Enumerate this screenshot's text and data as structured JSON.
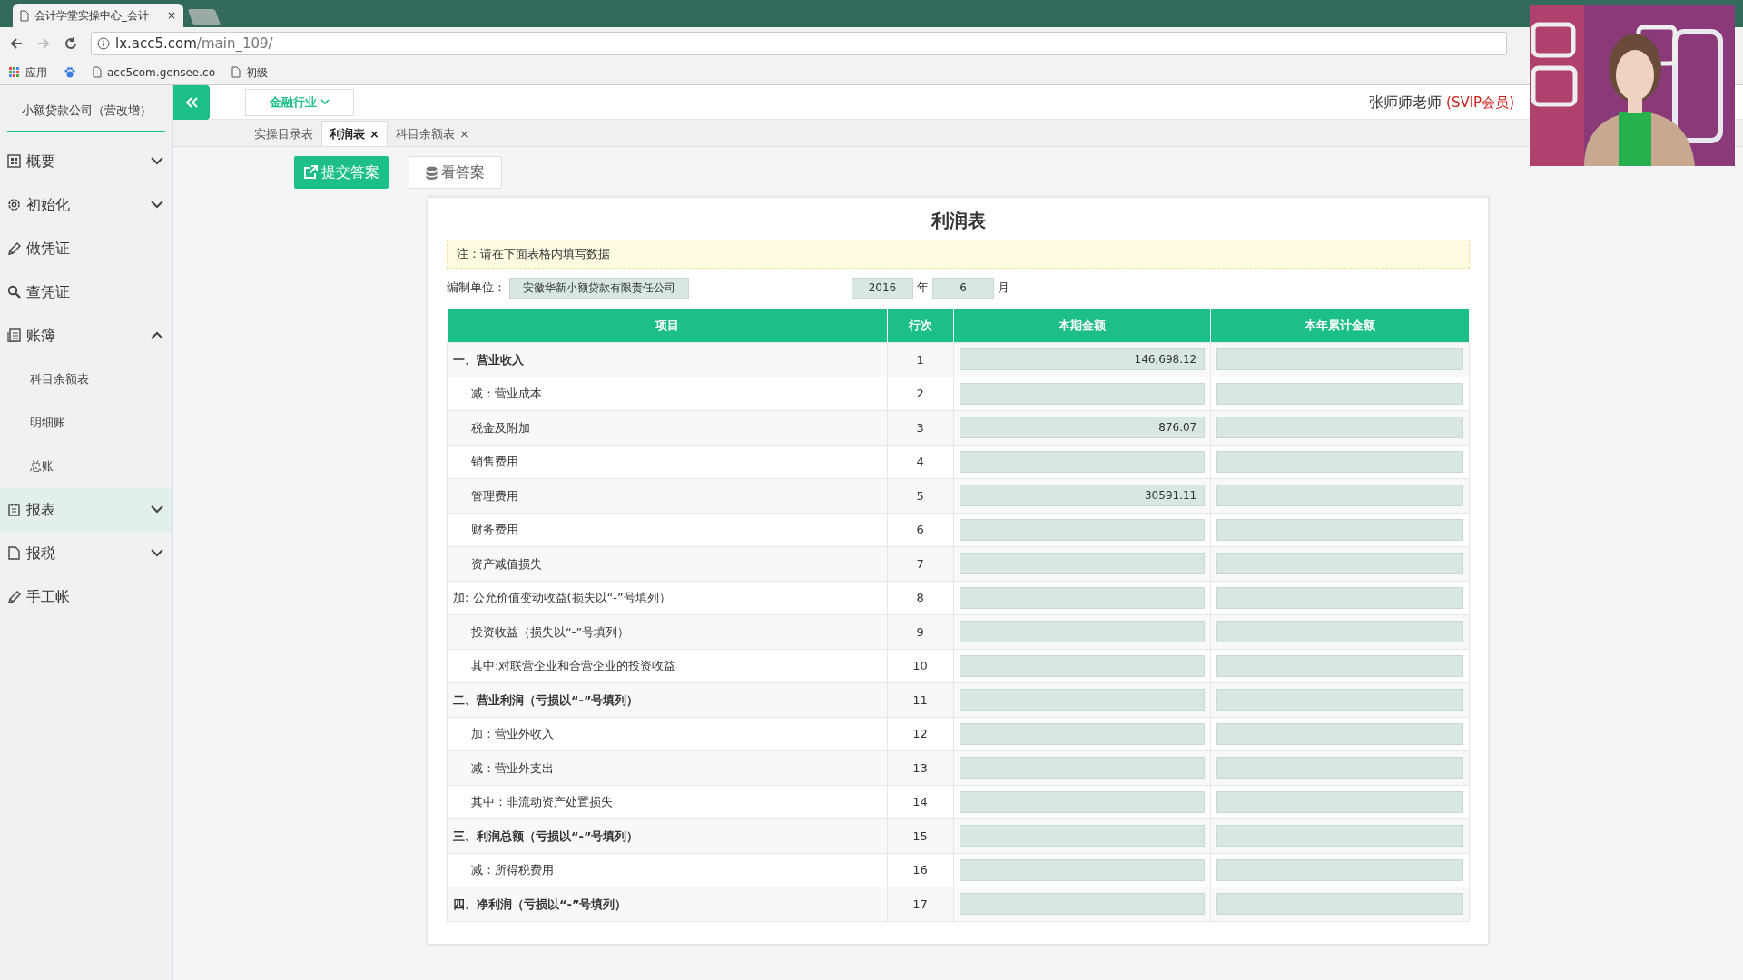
{
  "browser": {
    "tab_title": "会计学堂实操中心_会计",
    "tab_close": "×",
    "url_host": "lx.acc5.com",
    "url_path": "/main_109/",
    "bookmarks": [
      "应用",
      "acc5com.gensee.co",
      "初级"
    ]
  },
  "header": {
    "industry": "金融行业",
    "user": "张师师老师",
    "membership": "(SVIP会员)"
  },
  "sidebar": {
    "company": "小额贷款公司（营改增）",
    "items": [
      {
        "label": "概要",
        "kind": "group",
        "expanded": false,
        "selected": false
      },
      {
        "label": "初始化",
        "kind": "group",
        "expanded": false,
        "selected": false
      },
      {
        "label": "做凭证",
        "kind": "link",
        "selected": false
      },
      {
        "label": "查凭证",
        "kind": "link",
        "selected": false
      },
      {
        "label": "账簿",
        "kind": "group",
        "expanded": true,
        "selected": false,
        "children": [
          {
            "label": "科目余额表"
          },
          {
            "label": "明细账"
          },
          {
            "label": "总账"
          }
        ]
      },
      {
        "label": "报表",
        "kind": "group",
        "expanded": false,
        "selected": true
      },
      {
        "label": "报税",
        "kind": "group",
        "expanded": false,
        "selected": false
      },
      {
        "label": "手工帐",
        "kind": "link",
        "selected": false
      }
    ]
  },
  "tabs": [
    {
      "label": "实操目录表",
      "selected": false
    },
    {
      "label": "利润表",
      "selected": true,
      "close": "×"
    },
    {
      "label": "科目余额表",
      "selected": false,
      "close": "×"
    }
  ],
  "toolbar": [
    {
      "label": "提交答案",
      "kind": "primary"
    },
    {
      "label": "看答案",
      "kind": "secondary"
    }
  ],
  "report": {
    "title": "利润表",
    "note": "注：请在下面表格内填写数据",
    "unit_label": "编制单位：",
    "unit": "安徽华新小额贷款有限责任公司",
    "year": "2016",
    "year_label": "年",
    "month": "6",
    "month_label": "月",
    "columns": [
      "项目",
      "行次",
      "本期金额",
      "本年累计金额"
    ],
    "rows": [
      {
        "item": "一、营业收入",
        "kind": "main",
        "line": "1",
        "current": "146,698.12"
      },
      {
        "item": "减：营业成本",
        "kind": "sub",
        "line": "2"
      },
      {
        "item": "税金及附加",
        "kind": "sub",
        "line": "3",
        "current": "876.07"
      },
      {
        "item": "销售费用",
        "kind": "sub",
        "line": "4"
      },
      {
        "item": "管理费用",
        "kind": "sub",
        "line": "5",
        "current": "30591.11"
      },
      {
        "item": "财务费用",
        "kind": "sub",
        "line": "6"
      },
      {
        "item": "资产减值损失",
        "kind": "sub",
        "line": "7"
      },
      {
        "item": "加: 公允价值变动收益(损失以“-”号填列）",
        "kind": "plain",
        "line": "8"
      },
      {
        "item": "投资收益（损失以“-”号填列）",
        "kind": "sub",
        "line": "9"
      },
      {
        "item": "其中:对联营企业和合营企业的投资收益",
        "kind": "sub",
        "line": "10"
      },
      {
        "item": "二、营业利润（亏损以“-”号填列）",
        "kind": "main",
        "line": "11"
      },
      {
        "item": "加：营业外收入",
        "kind": "sub",
        "line": "12"
      },
      {
        "item": "减：营业外支出",
        "kind": "sub",
        "line": "13"
      },
      {
        "item": "其中：非流动资产处置损失",
        "kind": "sub",
        "line": "14"
      },
      {
        "item": "三、利润总额（亏损以“-”号填列）",
        "kind": "main",
        "line": "15"
      },
      {
        "item": "减：所得税费用",
        "kind": "sub",
        "line": "16"
      },
      {
        "item": "四、净利润（亏损以“-”号填列）",
        "kind": "main",
        "line": "17"
      }
    ]
  }
}
